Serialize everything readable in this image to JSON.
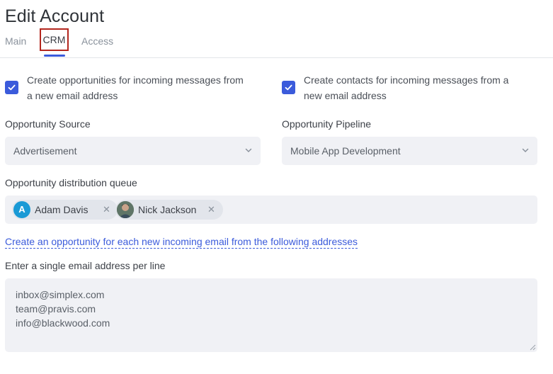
{
  "page": {
    "title": "Edit Account"
  },
  "tabs": [
    {
      "label": "Main"
    },
    {
      "label": "CRM"
    },
    {
      "label": "Access"
    }
  ],
  "options": {
    "create_opportunities": {
      "label_line1": "Create opportunities for incoming messages from",
      "label_line2": "a new email address",
      "checked": true
    },
    "create_contacts": {
      "label_line1": "Create contacts for incoming messages from a",
      "label_line2": "new email address",
      "checked": true
    }
  },
  "opportunity_source": {
    "label": "Opportunity Source",
    "value": "Advertisement"
  },
  "opportunity_pipeline": {
    "label": "Opportunity Pipeline",
    "value": "Mobile App Development"
  },
  "distribution_queue": {
    "label": "Opportunity distribution queue",
    "members": [
      {
        "name": "Adam Davis",
        "initial": "A"
      },
      {
        "name": "Nick Jackson"
      }
    ]
  },
  "link": {
    "text": "Create an opportunity for each new incoming email from the following addresses"
  },
  "emails": {
    "label": "Enter a single email address per line",
    "lines": [
      "inbox@simplex.com",
      "team@pravis.com",
      "info@blackwood.com"
    ]
  },
  "colors": {
    "accent": "#3b5bdb",
    "highlight_border": "#b3261e",
    "field_bg": "#f0f1f5",
    "avatar_bg": "#1a9ad6"
  }
}
